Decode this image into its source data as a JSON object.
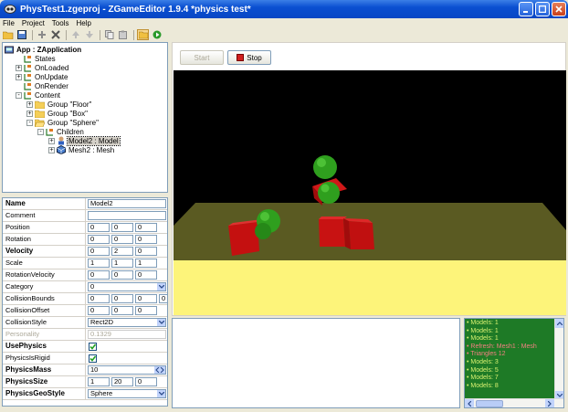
{
  "window": {
    "title": "PhysTest1.zgeproj - ZGameEditor 1.9.4 *physics test*"
  },
  "menu": [
    "File",
    "Project",
    "Tools",
    "Help"
  ],
  "tree": [
    {
      "label": "App : ZApplication",
      "indent": 0,
      "icon": "app-icon",
      "expander": "",
      "bold": true
    },
    {
      "label": "States",
      "indent": 1,
      "icon": "component-icon",
      "expander": ""
    },
    {
      "label": "OnLoaded",
      "indent": 1,
      "icon": "component-icon",
      "expander": "+"
    },
    {
      "label": "OnUpdate",
      "indent": 1,
      "icon": "component-icon",
      "expander": "+"
    },
    {
      "label": "OnRender",
      "indent": 1,
      "icon": "component-icon",
      "expander": ""
    },
    {
      "label": "Content",
      "indent": 1,
      "icon": "component-icon",
      "expander": "-"
    },
    {
      "label": "Group \"Floor\"",
      "indent": 2,
      "icon": "folder-icon",
      "expander": "+"
    },
    {
      "label": "Group \"Box\"",
      "indent": 2,
      "icon": "folder-icon",
      "expander": "+"
    },
    {
      "label": "Group \"Sphere\"",
      "indent": 2,
      "icon": "folder-open-icon",
      "expander": "-"
    },
    {
      "label": "Children",
      "indent": 3,
      "icon": "component-icon",
      "expander": "-"
    },
    {
      "label": "Model2 : Model",
      "indent": 4,
      "icon": "model-icon",
      "expander": "+",
      "selected": true
    },
    {
      "label": "Mesh2 : Mesh",
      "indent": 4,
      "icon": "mesh-icon",
      "expander": "+"
    }
  ],
  "props": [
    {
      "name": "Name",
      "bold": true,
      "fields": [
        "Model2"
      ],
      "type": "text"
    },
    {
      "name": "Comment",
      "fields": [
        ""
      ],
      "type": "text"
    },
    {
      "name": "Position",
      "fields": [
        "0",
        "0",
        "0"
      ],
      "type": "vec3"
    },
    {
      "name": "Rotation",
      "fields": [
        "0",
        "0",
        "0"
      ],
      "type": "vec3"
    },
    {
      "name": "Velocity",
      "bold": true,
      "fields": [
        "0",
        "2",
        "0"
      ],
      "type": "vec3"
    },
    {
      "name": "Scale",
      "fields": [
        "1",
        "1",
        "1"
      ],
      "type": "vec3"
    },
    {
      "name": "RotationVelocity",
      "fields": [
        "0",
        "0",
        "0"
      ],
      "type": "vec3"
    },
    {
      "name": "Category",
      "fields": [
        "0"
      ],
      "type": "combo"
    },
    {
      "name": "CollisionBounds",
      "fields": [
        "0",
        "0",
        "0",
        "0"
      ],
      "type": "vec4"
    },
    {
      "name": "CollisionOffset",
      "fields": [
        "0",
        "0",
        "0"
      ],
      "type": "vec3"
    },
    {
      "name": "CollisionStyle",
      "fields": [
        "Rect2D"
      ],
      "type": "combo"
    },
    {
      "name": "Personality",
      "gray": true,
      "fields": [
        "0.1329"
      ],
      "type": "text"
    },
    {
      "name": "UsePhysics",
      "bold": true,
      "fields": [],
      "type": "check",
      "checked": true
    },
    {
      "name": "PhysicsIsRigid",
      "fields": [],
      "type": "check",
      "checked": true
    },
    {
      "name": "PhysicsMass",
      "bold": true,
      "fields": [
        "10"
      ],
      "type": "spin"
    },
    {
      "name": "PhysicsSize",
      "bold": true,
      "fields": [
        "1",
        "20",
        "0"
      ],
      "type": "vec3"
    },
    {
      "name": "PhysicsGeoStyle",
      "bold": true,
      "fields": [
        "Sphere"
      ],
      "type": "combo"
    }
  ],
  "buttons": {
    "start": "Start",
    "stop": "Stop"
  },
  "console": [
    {
      "text": "Models: 1",
      "color": "#d8f070"
    },
    {
      "text": "Models: 1",
      "color": "#d8f070"
    },
    {
      "text": "Models: 1",
      "color": "#d8f070"
    },
    {
      "text": "Refresh: Mesh1 : Mesh",
      "color": "#f08080"
    },
    {
      "text": "Triangles 12",
      "color": "#f08080"
    },
    {
      "text": "Models: 3",
      "color": "#d8f070"
    },
    {
      "text": "Models: 5",
      "color": "#d8f070"
    },
    {
      "text": "Models: 7",
      "color": "#d8f070"
    },
    {
      "text": "Models: 8",
      "color": "#d8f070"
    }
  ],
  "colors": {
    "sky": "#000000",
    "floor_far": "#5a5a22",
    "floor_near": "#fdf47a",
    "box": "#cc1111",
    "sphere": "#2fae20",
    "console_bg": "#1e7a26"
  }
}
